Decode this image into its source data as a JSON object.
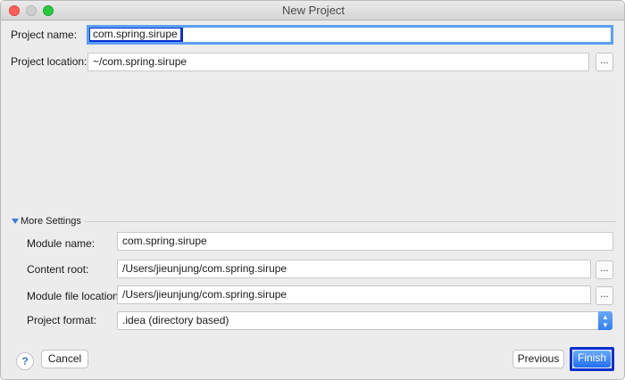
{
  "window": {
    "title": "New Project"
  },
  "project": {
    "name_label": "Project name:",
    "name_value": "com.spring.sirupe",
    "location_label": "Project location:",
    "location_value": "~/com.spring.sirupe",
    "browse_label": "..."
  },
  "more_settings": {
    "header": "More Settings",
    "expanded": true,
    "module_name_label": "Module name:",
    "module_name_value": "com.spring.sirupe",
    "content_root_label": "Content root:",
    "content_root_value": "/Users/jieunjung/com.spring.sirupe",
    "module_file_location_label": "Module file location:",
    "module_file_location_value": "/Users/jieunjung/com.spring.sirupe",
    "project_format_label": "Project format:",
    "project_format_value": ".idea (directory based)",
    "browse_label": "..."
  },
  "footer": {
    "help_label": "?",
    "cancel_label": "Cancel",
    "previous_label": "Previous",
    "finish_label": "Finish"
  },
  "colors": {
    "accent": "#3d7bd8",
    "focus_ring": "#5b9ff5",
    "highlight_box": "#0a2fd0"
  }
}
